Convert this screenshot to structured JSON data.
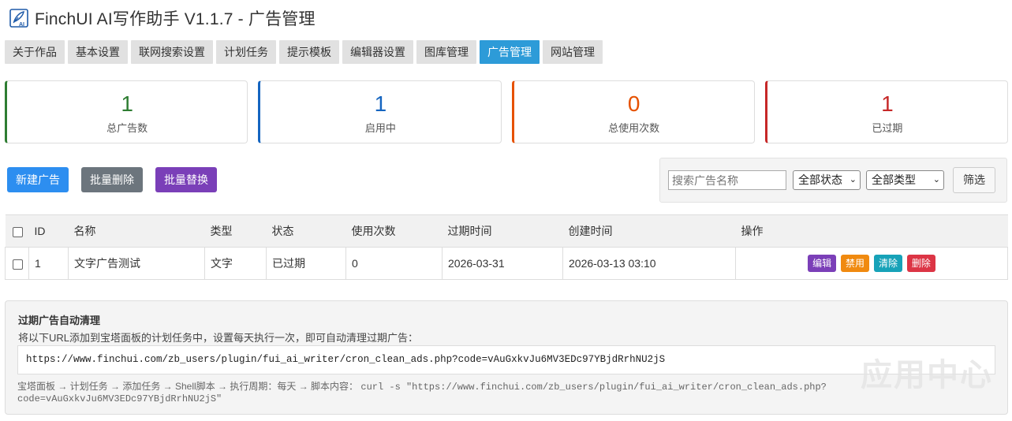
{
  "app": {
    "title": "FinchUI AI写作助手 V1.1.7 - 广告管理"
  },
  "tabs": [
    {
      "label": "关于作品",
      "active": false
    },
    {
      "label": "基本设置",
      "active": false
    },
    {
      "label": "联网搜索设置",
      "active": false
    },
    {
      "label": "计划任务",
      "active": false
    },
    {
      "label": "提示模板",
      "active": false
    },
    {
      "label": "编辑器设置",
      "active": false
    },
    {
      "label": "图库管理",
      "active": false
    },
    {
      "label": "广告管理",
      "active": true
    },
    {
      "label": "网站管理",
      "active": false
    }
  ],
  "stats": [
    {
      "value": "1",
      "label": "总广告数",
      "color": "#2e7d32"
    },
    {
      "value": "1",
      "label": "启用中",
      "color": "#1565c0"
    },
    {
      "value": "0",
      "label": "总使用次数",
      "color": "#e65100"
    },
    {
      "value": "1",
      "label": "已过期",
      "color": "#c62828"
    }
  ],
  "actions": {
    "new_label": "新建广告",
    "bulk_delete_label": "批量删除",
    "bulk_replace_label": "批量替换"
  },
  "colors": {
    "new": "#2d8ef0",
    "bulk_delete": "#6c757d",
    "bulk_replace": "#7a3fb8",
    "edit": "#7b3fb8",
    "disable": "#f08a10",
    "clear": "#17a2b8",
    "delete": "#dc3545"
  },
  "filter": {
    "search_placeholder": "搜索广告名称",
    "status_selected": "全部状态",
    "type_selected": "全部类型",
    "submit_label": "筛选"
  },
  "table": {
    "columns": [
      "ID",
      "名称",
      "类型",
      "状态",
      "使用次数",
      "过期时间",
      "创建时间",
      "操作"
    ],
    "rows": [
      {
        "id": "1",
        "name": "文字广告测试",
        "type": "文字",
        "status": "已过期",
        "uses": "0",
        "expire": "2026-03-31",
        "created": "2026-03-13 03:10"
      }
    ],
    "op_labels": {
      "edit": "编辑",
      "disable": "禁用",
      "clear": "清除",
      "delete": "删除"
    }
  },
  "cron": {
    "title": "过期广告自动清理",
    "desc": "将以下URL添加到宝塔面板的计划任务中，设置每天执行一次，即可自动清理过期广告：",
    "url": "https://www.finchui.com/zb_users/plugin/fui_ai_writer/cron_clean_ads.php?code=vAuGxkvJu6MV3EDc97YBjdRrhNU2jS",
    "steps": "宝塔面板 → 计划任务 → 添加任务 → Shell脚本 → 执行周期：每天 → 脚本内容：",
    "command": "curl -s \"https://www.finchui.com/zb_users/plugin/fui_ai_writer/cron_clean_ads.php?code=vAuGxkvJu6MV3EDc97YBjdRrhNU2jS\""
  },
  "watermark": "应用中心"
}
